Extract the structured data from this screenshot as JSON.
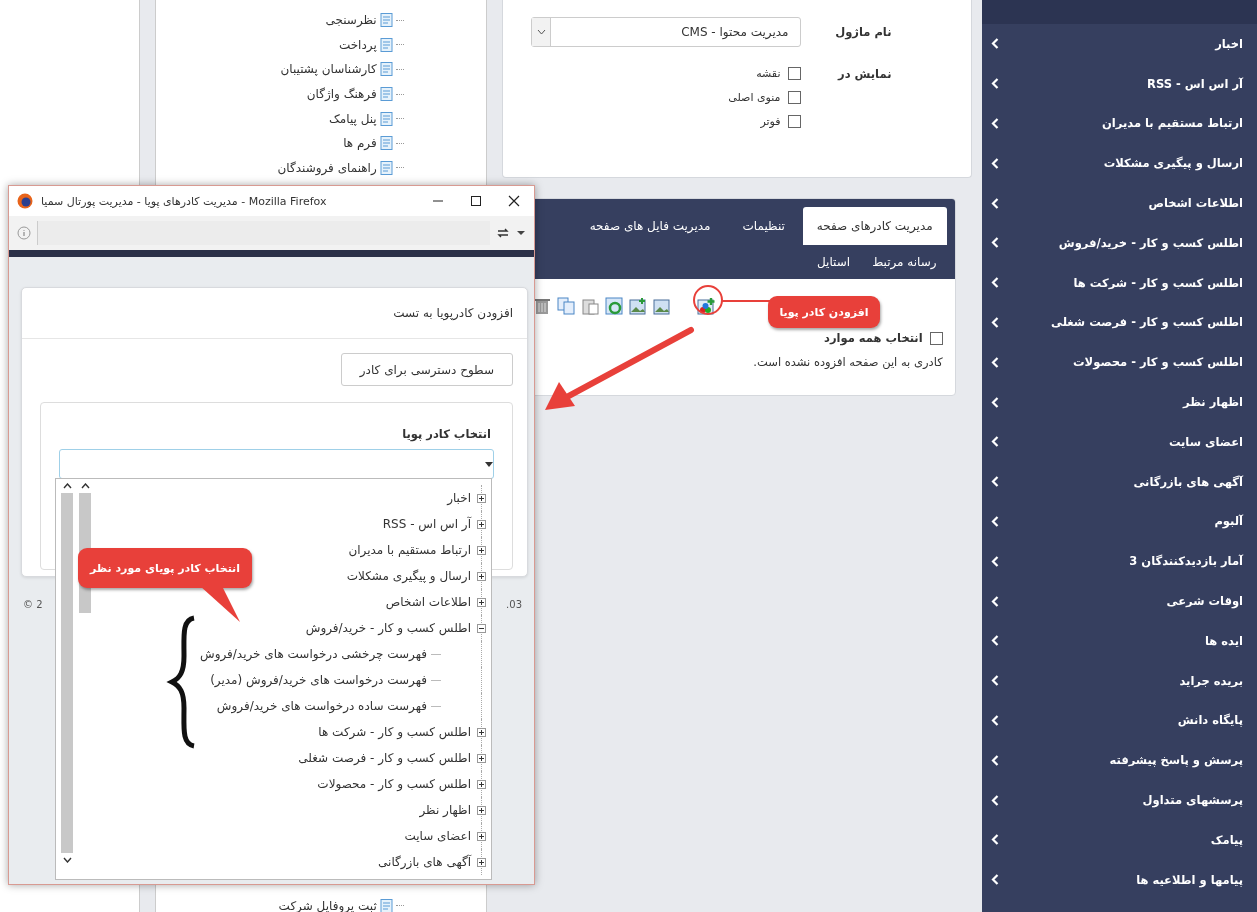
{
  "tree_panel": {
    "items": [
      "نظرسنجی",
      "پرداخت",
      "کارشناسان پشتیبان",
      "فرهنگ واژگان",
      "پنل پیامک",
      "فرم ها",
      "راهنمای فروشندگان"
    ],
    "bottom_item": "ثبت پروفایل شرکت"
  },
  "module_form": {
    "module_label": "نام ماژول",
    "module_value": "مدیریت محتوا - CMS",
    "display_label": "نمایش در",
    "options": [
      {
        "label": "نقشه",
        "checked": false
      },
      {
        "label": "منوی اصلی",
        "checked": false
      },
      {
        "label": "فوتر",
        "checked": false
      }
    ]
  },
  "frames_panel": {
    "tabs": [
      {
        "label": "مدیریت کادرهای صفحه",
        "selected": true
      },
      {
        "label": "تنظیمات",
        "selected": false
      },
      {
        "label": "مدیریت فایل های صفحه",
        "selected": false
      }
    ],
    "subtabs": [
      "رسانه مرتبط",
      "استایل"
    ],
    "select_all": {
      "label": "انتخاب همه موارد",
      "checked": false
    },
    "empty_message": "کادری به این صفحه افزوده نشده است."
  },
  "browser_window": {
    "title": "مدیریت کادرهای پویا - مدیریت پورتال سمیا - Mozilla Firefox",
    "dialog": {
      "title": "افزودن کادرپویا به تست",
      "access_button": "سطوح دسترسی برای کادر",
      "select_label": "انتخاب کادر پویا",
      "options": [
        {
          "label": "اخبار",
          "expanded": false
        },
        {
          "label": "آر اس اس - RSS",
          "expanded": false
        },
        {
          "label": "ارتباط مستقیم با مدیران",
          "expanded": false
        },
        {
          "label": "ارسال و پیگیری مشکلات",
          "expanded": false
        },
        {
          "label": "اطلاعات اشخاص",
          "expanded": false
        },
        {
          "label": "اطلس کسب و کار - خرید/فروش",
          "expanded": true,
          "children": [
            {
              "label": "فهرست چرخشی درخواست های خرید/فروش"
            },
            {
              "label": "فهرست درخواست های خرید/فروش (مدیر)"
            },
            {
              "label": "فهرست ساده درخواست های خرید/فروش"
            }
          ]
        },
        {
          "label": "اطلس کسب و کار - شرکت ها",
          "expanded": false
        },
        {
          "label": "اطلس کسب و کار - فرصت شغلی",
          "expanded": false
        },
        {
          "label": "اطلس کسب و کار - محصولات",
          "expanded": false
        },
        {
          "label": "اظهار نظر",
          "expanded": false
        },
        {
          "label": "اعضای سایت",
          "expanded": false
        },
        {
          "label": "آگهی های بازرگانی",
          "expanded": false
        }
      ]
    },
    "footer_left": "© 2",
    "footer_right": ".03"
  },
  "callouts": [
    "افزودن کادر پویا",
    "انتخاب کادر پویای مورد نظر"
  ],
  "sidebar": {
    "items": [
      "اخبار",
      "آر اس اس - RSS",
      "ارتباط مستقیم با مدیران",
      "ارسال و پیگیری مشکلات",
      "اطلاعات اشخاص",
      "اطلس کسب و کار - خرید/فروش",
      "اطلس کسب و کار - شرکت ها",
      "اطلس کسب و کار - فرصت شغلی",
      "اطلس کسب و کار - محصولات",
      "اظهار نظر",
      "اعضای سایت",
      "آگهی های بازرگانی",
      "آلبوم",
      "آمار بازدیدکنندگان 3",
      "اوقات شرعی",
      "ایده ها",
      "بریده جراید",
      "پایگاه دانش",
      "پرسش و پاسخ پیشرفته",
      "پرسشهای متداول",
      "پیامک",
      "پیامها و اطلاعیه ها"
    ]
  }
}
